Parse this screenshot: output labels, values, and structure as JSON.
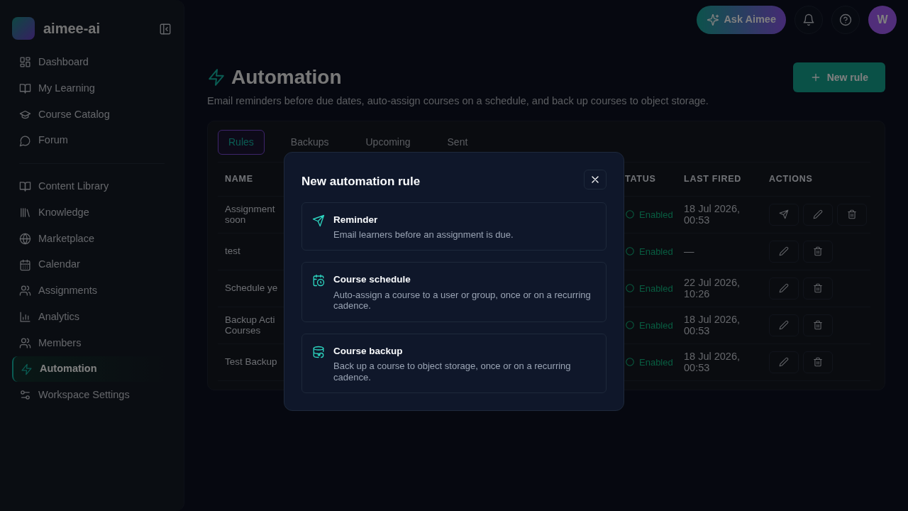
{
  "sidebar": {
    "brand": "aimee-ai",
    "groups": [
      [
        {
          "label": "Dashboard",
          "selected": false
        },
        {
          "label": "My Learning",
          "selected": false
        },
        {
          "label": "Course Catalog",
          "selected": false
        },
        {
          "label": "Forum",
          "selected": false
        }
      ],
      [
        {
          "label": "Content Library",
          "selected": false
        },
        {
          "label": "Knowledge",
          "selected": false
        },
        {
          "label": "Marketplace",
          "selected": false
        },
        {
          "label": "Calendar",
          "selected": false
        },
        {
          "label": "Assignments",
          "selected": false
        },
        {
          "label": "Analytics",
          "selected": false
        },
        {
          "label": "Members",
          "selected": false
        },
        {
          "label": "Automation",
          "selected": true
        },
        {
          "label": "Workspace Settings",
          "selected": false
        }
      ]
    ]
  },
  "topbar": {
    "ask_button": "Ask Aimee",
    "avatar": "W"
  },
  "page": {
    "title": "Automation",
    "subtitle": "Email reminders before due dates, auto-assign courses on a schedule, and back up courses to object storage.",
    "new_button": "New rule"
  },
  "tabs": [
    {
      "label": "Rules",
      "selected": true
    },
    {
      "label": "Backups",
      "selected": false
    },
    {
      "label": "Upcoming",
      "selected": false
    },
    {
      "label": "Sent",
      "selected": false
    }
  ],
  "table": {
    "columns": [
      "NAME",
      "TATUS",
      "LAST FIRED",
      "ACTIONS"
    ],
    "rows": [
      {
        "name": "Assignment\nsoon",
        "status": "Enabled",
        "last_fired": "18 Jul 2026, 00:53",
        "actions": [
          {
            "kind": "send"
          },
          {
            "kind": "edit"
          },
          {
            "kind": "delete"
          }
        ]
      },
      {
        "name": "test",
        "status": "Enabled",
        "last_fired": "—",
        "actions": [
          {
            "kind": "edit"
          },
          {
            "kind": "delete"
          }
        ]
      },
      {
        "name": "Schedule ye",
        "status": "Enabled",
        "last_fired": "22 Jul 2026, 10:26",
        "actions": [
          {
            "kind": "edit"
          },
          {
            "kind": "delete"
          }
        ]
      },
      {
        "name": "Backup Acti\nCourses",
        "status": "Enabled",
        "last_fired": "18 Jul 2026, 00:53",
        "actions": [
          {
            "kind": "edit"
          },
          {
            "kind": "delete"
          }
        ]
      },
      {
        "name": "Test Backup",
        "status": "Enabled",
        "last_fired": "18 Jul 2026, 00:53",
        "actions": [
          {
            "kind": "edit"
          },
          {
            "kind": "delete"
          }
        ]
      }
    ]
  },
  "modal": {
    "title": "New automation rule",
    "options": [
      {
        "kind": "reminder",
        "title": "Reminder",
        "description": "Email learners before an assignment is due."
      },
      {
        "kind": "schedule",
        "title": "Course schedule",
        "description": "Auto-assign a course to a user or group, once or on a recurring cadence."
      },
      {
        "kind": "backup",
        "title": "Course backup",
        "description": "Back up a course to object storage, once or on a recurring cadence."
      }
    ]
  }
}
